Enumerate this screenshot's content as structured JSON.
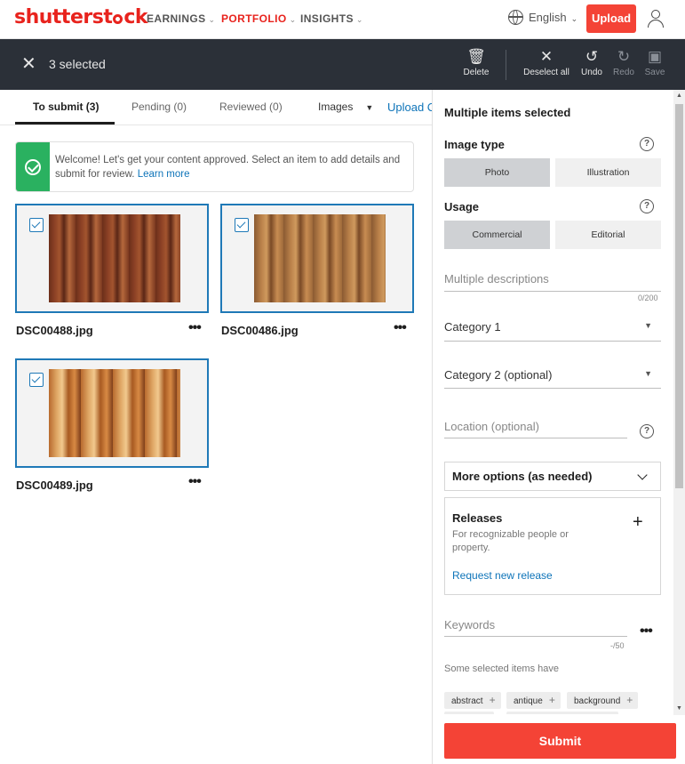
{
  "brand": {
    "logo_pre": "shutterst",
    "logo_post": "ck"
  },
  "nav": {
    "items": [
      {
        "label": "EARNINGS",
        "active": false
      },
      {
        "label": "PORTFOLIO",
        "active": true
      },
      {
        "label": "INSIGHTS",
        "active": false
      }
    ],
    "language": "English",
    "upload_label": "Upload",
    "accent_color": "#f44336"
  },
  "toolbar": {
    "selected_label": "3 selected",
    "actions": {
      "delete": "Delete",
      "deselect_all": "Deselect all",
      "undo": "Undo",
      "redo": "Redo",
      "save": "Save"
    }
  },
  "tabs": {
    "items": [
      "To submit (3)",
      "Pending (0)",
      "Reviewed (0)"
    ],
    "filter": "Images",
    "upload_link": "Upload C"
  },
  "welcome": {
    "text": "Welcome! Let's get your content approved. Select an item to add details and submit for review.",
    "link": "Learn more"
  },
  "assets": [
    {
      "filename": "DSC00488.jpg",
      "selected": true
    },
    {
      "filename": "DSC00486.jpg",
      "selected": true
    },
    {
      "filename": "DSC00489.jpg",
      "selected": true
    }
  ],
  "panel": {
    "title": "Multiple items selected",
    "image_type": {
      "label": "Image type",
      "options": [
        "Photo",
        "Illustration"
      ],
      "selected": "Photo"
    },
    "usage": {
      "label": "Usage",
      "options": [
        "Commercial",
        "Editorial"
      ],
      "selected": "Commercial"
    },
    "description": {
      "placeholder": "Multiple descriptions",
      "counter": "0/200"
    },
    "category1": "Category 1",
    "category2": "Category 2 (optional)",
    "location": "Location (optional)",
    "more_options": "More options (as needed)",
    "releases": {
      "title": "Releases",
      "description": "For recognizable people or property.",
      "link": "Request new release"
    },
    "keywords": {
      "placeholder": "Keywords",
      "counter": "-/50"
    },
    "keywords_note": "Some selected items have",
    "keyword_chips": [
      "abstract",
      "antique",
      "background"
    ],
    "submit_label": "Submit"
  }
}
